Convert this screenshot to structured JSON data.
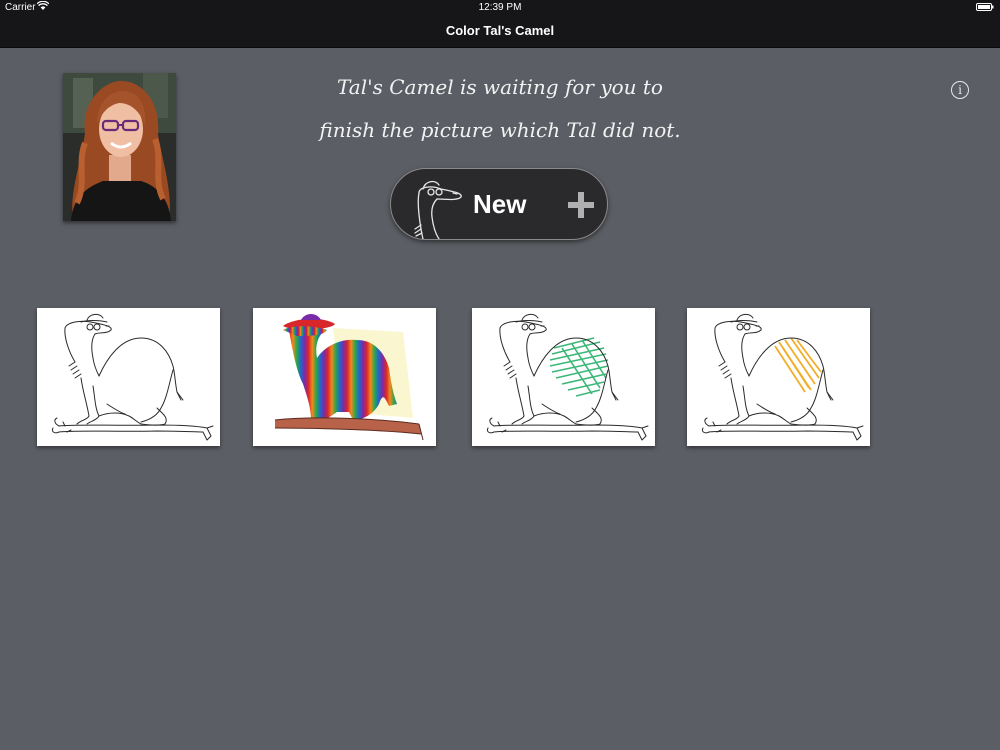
{
  "status_bar": {
    "carrier": "Carrier",
    "time": "12:39 PM"
  },
  "nav": {
    "title": "Color Tal's Camel"
  },
  "message": {
    "line1": "Tal's Camel is waiting for you to",
    "line2": "finish the picture which Tal did not."
  },
  "info_button": {
    "icon": "info-icon",
    "glyph": "i"
  },
  "new_button": {
    "label": "New",
    "icon": "plus-icon"
  },
  "colors": {
    "background": "#5b5e64",
    "bar": "#161618",
    "button": "#2a2a2d",
    "green_fill": "#27b06a",
    "orange_fill": "#f2a91e"
  },
  "drawings": [
    {
      "name": "camel-outline-uncolored",
      "fill": "none"
    },
    {
      "name": "camel-rainbow-colored",
      "fill": "rainbow"
    },
    {
      "name": "camel-green-hump",
      "fill": "green"
    },
    {
      "name": "camel-orange-hump",
      "fill": "orange"
    }
  ]
}
